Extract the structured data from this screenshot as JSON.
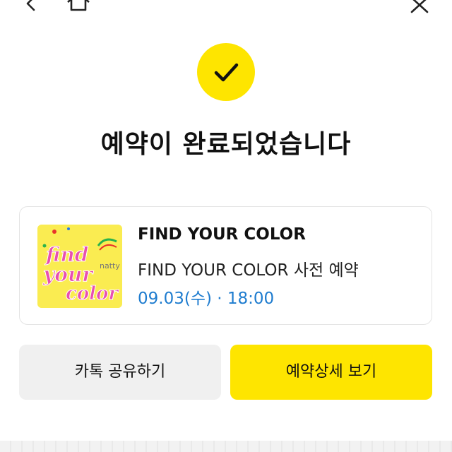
{
  "nav": {
    "back_icon": "chevron-left-icon",
    "home_icon": "home-icon",
    "close_icon": "close-icon"
  },
  "status": {
    "icon": "check-icon",
    "title": "예약이 완료되었습니다"
  },
  "reservation": {
    "event_title": "FIND YOUR COLOR",
    "event_subtitle": "FIND YOUR COLOR 사전 예약",
    "datetime": "09.03(수) · 18:00",
    "thumbnail_art": {
      "line1": "find",
      "line2": "your",
      "line3": "color",
      "side_text": "natty"
    }
  },
  "actions": {
    "share_label": "카톡 공유하기",
    "detail_label": "예약상세 보기"
  },
  "colors": {
    "accent": "#fee500",
    "datetime": "#1e7ccf",
    "secondary_button": "#f0f0f0"
  }
}
